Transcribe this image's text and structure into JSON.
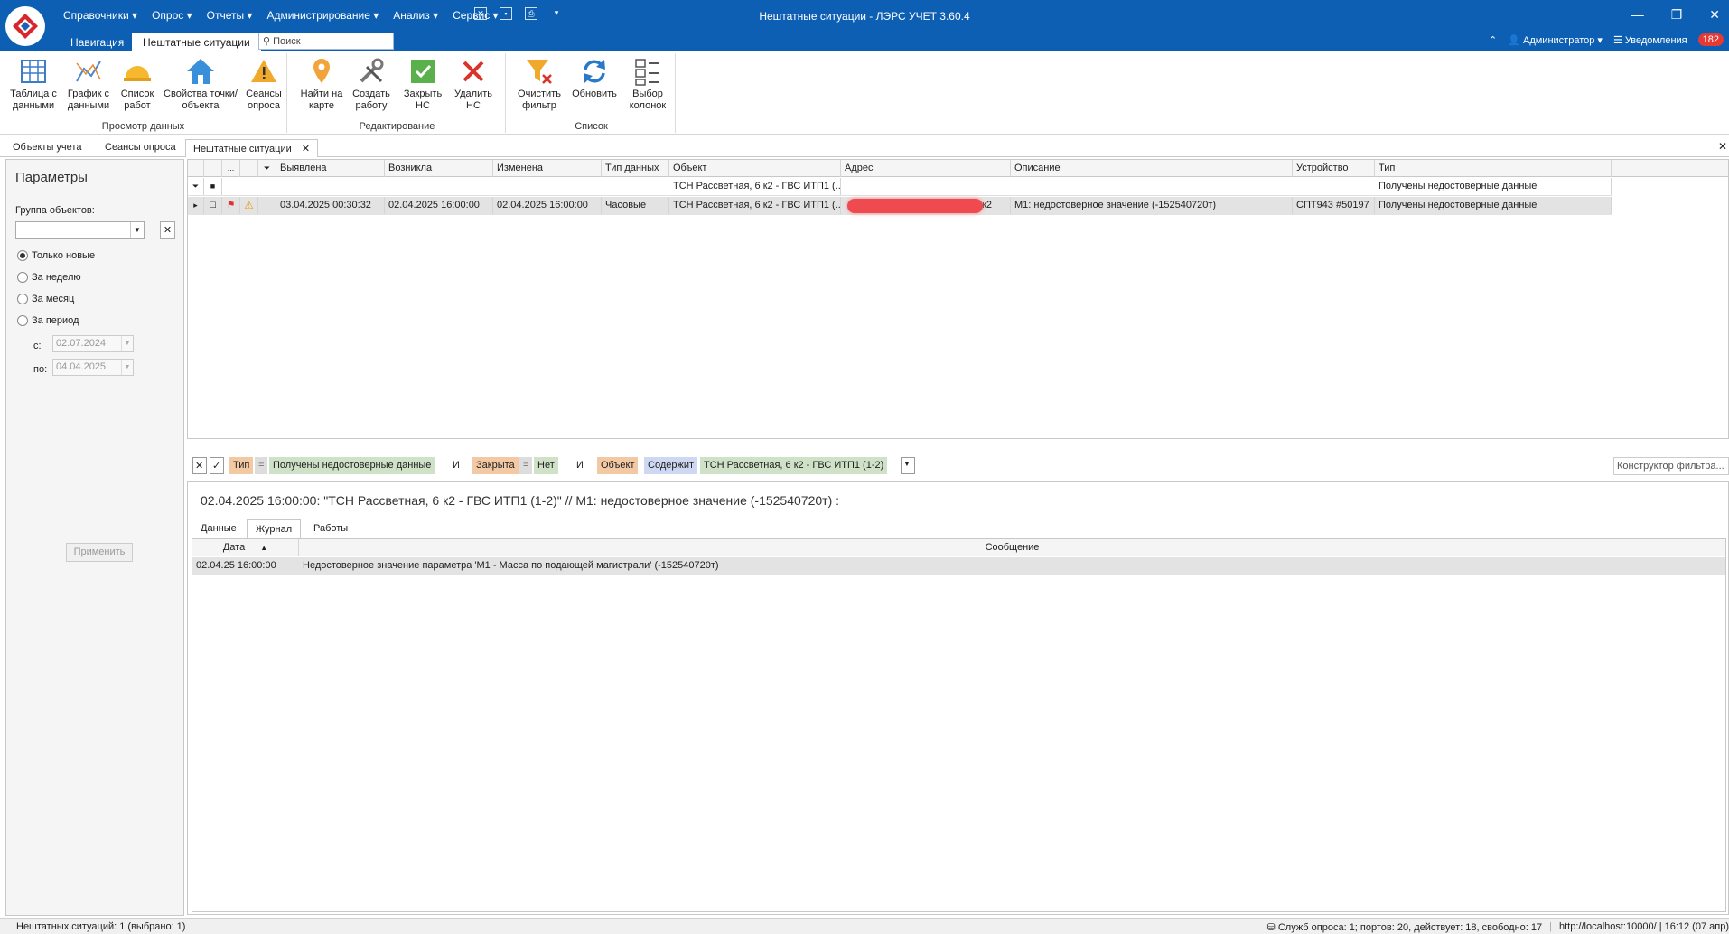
{
  "window": {
    "title": "Нештатные ситуации - ЛЭРС УЧЕТ 3.60.4"
  },
  "menu": [
    "Справочники",
    "Опрос",
    "Отчеты",
    "Администрирование",
    "Анализ",
    "Сервис"
  ],
  "ribbon_tabs": {
    "nav": "Навигация",
    "current": "Нештатные ситуации"
  },
  "search": {
    "placeholder": "Поиск"
  },
  "user": {
    "name": "Администратор",
    "notifications_label": "Уведомления",
    "notifications_count": "182"
  },
  "ribbon": {
    "view_group": "Просмотр данных",
    "edit_group": "Редактирование",
    "list_group": "Список",
    "buttons": {
      "table": "Таблица с данными",
      "graph": "График с данными",
      "worklist": "Список работ",
      "props": "Свойства точки/объекта",
      "sessions": "Сеансы опроса",
      "map": "Найти на карте",
      "creatework": "Создать работу",
      "close": "Закрыть НС",
      "delete": "Удалить НС",
      "clearfilter": "Очистить фильтр",
      "refresh": "Обновить",
      "columns": "Выбор колонок"
    }
  },
  "doc_tabs": [
    "Объекты учета",
    "Сеансы опроса",
    "Нештатные ситуации"
  ],
  "params": {
    "title": "Параметры",
    "group_label": "Группа объектов:",
    "radio_new": "Только новые",
    "radio_week": "За неделю",
    "radio_month": "За месяц",
    "radio_period": "За период",
    "from_label": "с:",
    "to_label": "по:",
    "from_date": "02.07.2024",
    "to_date": "04.04.2025",
    "apply": "Применить"
  },
  "grid": {
    "columns": {
      "ellipsis": "...",
      "detected": "Выявлена",
      "occurred": "Возникла",
      "changed": "Изменена",
      "datatype": "Тип данных",
      "object": "Объект",
      "address": "Адрес",
      "description": "Описание",
      "device": "Устройство",
      "type": "Тип"
    },
    "filter_row": {
      "object": "ТСН Рассветная, 6 к2 - ГВС ИТП1 (...",
      "type": "Получены недостоверные данные"
    },
    "rows": [
      {
        "detected": "03.04.2025 00:30:32",
        "occurred": "02.04.2025 16:00:00",
        "changed": "02.04.2025 16:00:00",
        "datatype": "Часовые",
        "object": "ТСН Рассветная, 6 к2 - ГВС ИТП1 (...",
        "address_tail": "6 к2",
        "description": "M1: недостоверное значение (-152540720т)",
        "device": "СПТ943 #50197",
        "type": "Получены недостоверные данные"
      }
    ]
  },
  "filterbar": {
    "f1_field": "Тип",
    "f1_op": "=",
    "f1_val": "Получены недостоверные данные",
    "and1": "И",
    "f2_field": "Закрыта",
    "f2_op": "=",
    "f2_val": "Нет",
    "and2": "И",
    "f3_field": "Объект",
    "f3_op": "Содержит",
    "f3_val": "ТСН Рассветная, 6 к2 - ГВС ИТП1 (1-2)",
    "constructor": "Конструктор фильтра..."
  },
  "detail": {
    "title": "02.04.2025 16:00:00: \"ТСН Рассветная, 6 к2 - ГВС ИТП1 (1-2)\" // M1: недостоверное значение (-152540720т) :",
    "tabs": [
      "Данные",
      "Журнал",
      "Работы"
    ],
    "columns": {
      "date": "Дата",
      "message": "Сообщение"
    },
    "rows": [
      {
        "date": "02.04.25 16:00:00",
        "message": "Недостоверное значение параметра 'M1 - Масса по подающей магистрали' (-152540720т)"
      }
    ]
  },
  "status": {
    "left": "Нештатных ситуаций: 1 (выбрано: 1)",
    "services": "Служб опроса: 1; портов: 20, действует: 18, свободно: 17",
    "url": "http://localhost:10000/ | 16:12 (07 апр)"
  },
  "colors": {
    "titlebar": "#0d5fb3",
    "badge": "#e53935",
    "selected_row": "#e3e3e3"
  }
}
